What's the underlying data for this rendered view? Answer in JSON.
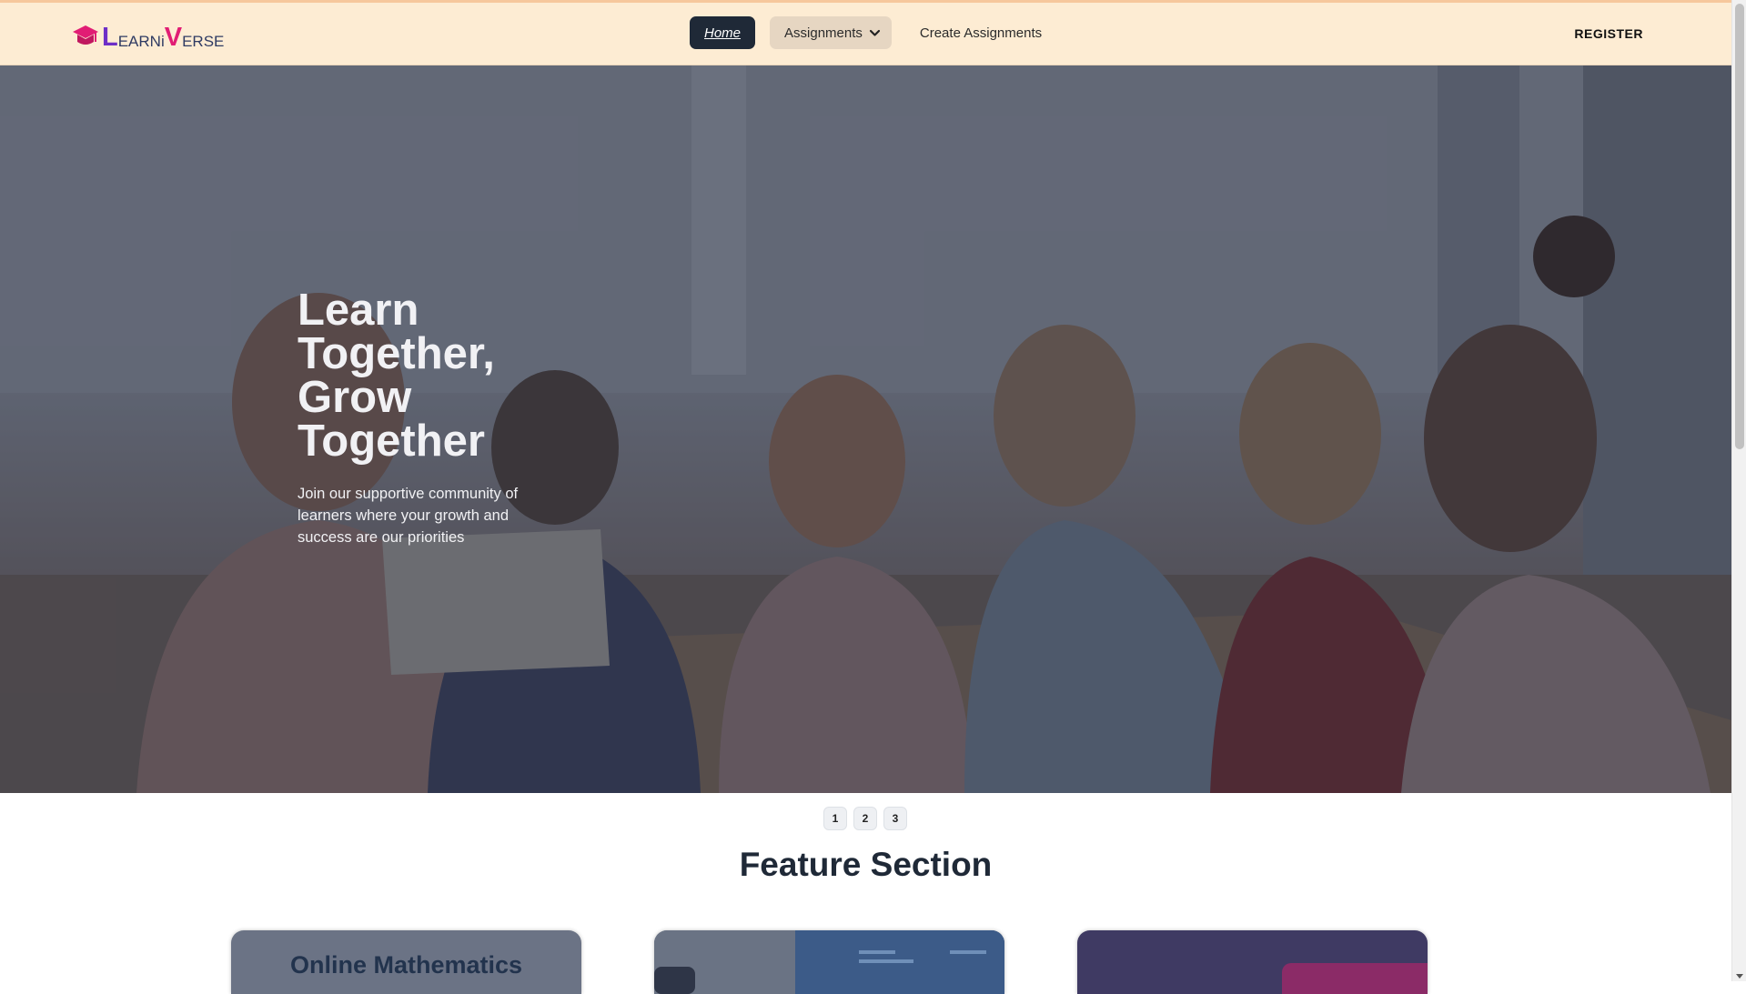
{
  "brand": {
    "name_parts": [
      "L",
      "EARNi",
      "V",
      "ERSE"
    ],
    "icon": "graduation-cap-icon",
    "colors": {
      "primary": "#6d2ec7",
      "accent": "#e11d74"
    }
  },
  "nav": {
    "home_label": "Home",
    "assignments_label": "Assignments",
    "assignments_icon": "chevron-down-icon",
    "create_label": "Create Assignments",
    "register_label": "REGISTER"
  },
  "hero": {
    "title": "Learn Together, Grow Together",
    "subtitle": "Join our supportive community of learners where your growth and success are our priorities"
  },
  "carousel": {
    "pages": [
      "1",
      "2",
      "3"
    ]
  },
  "features": {
    "title": "Feature Section",
    "cards": [
      {
        "title": "Online Mathematics"
      },
      {
        "title": ""
      },
      {
        "title": ""
      }
    ]
  }
}
